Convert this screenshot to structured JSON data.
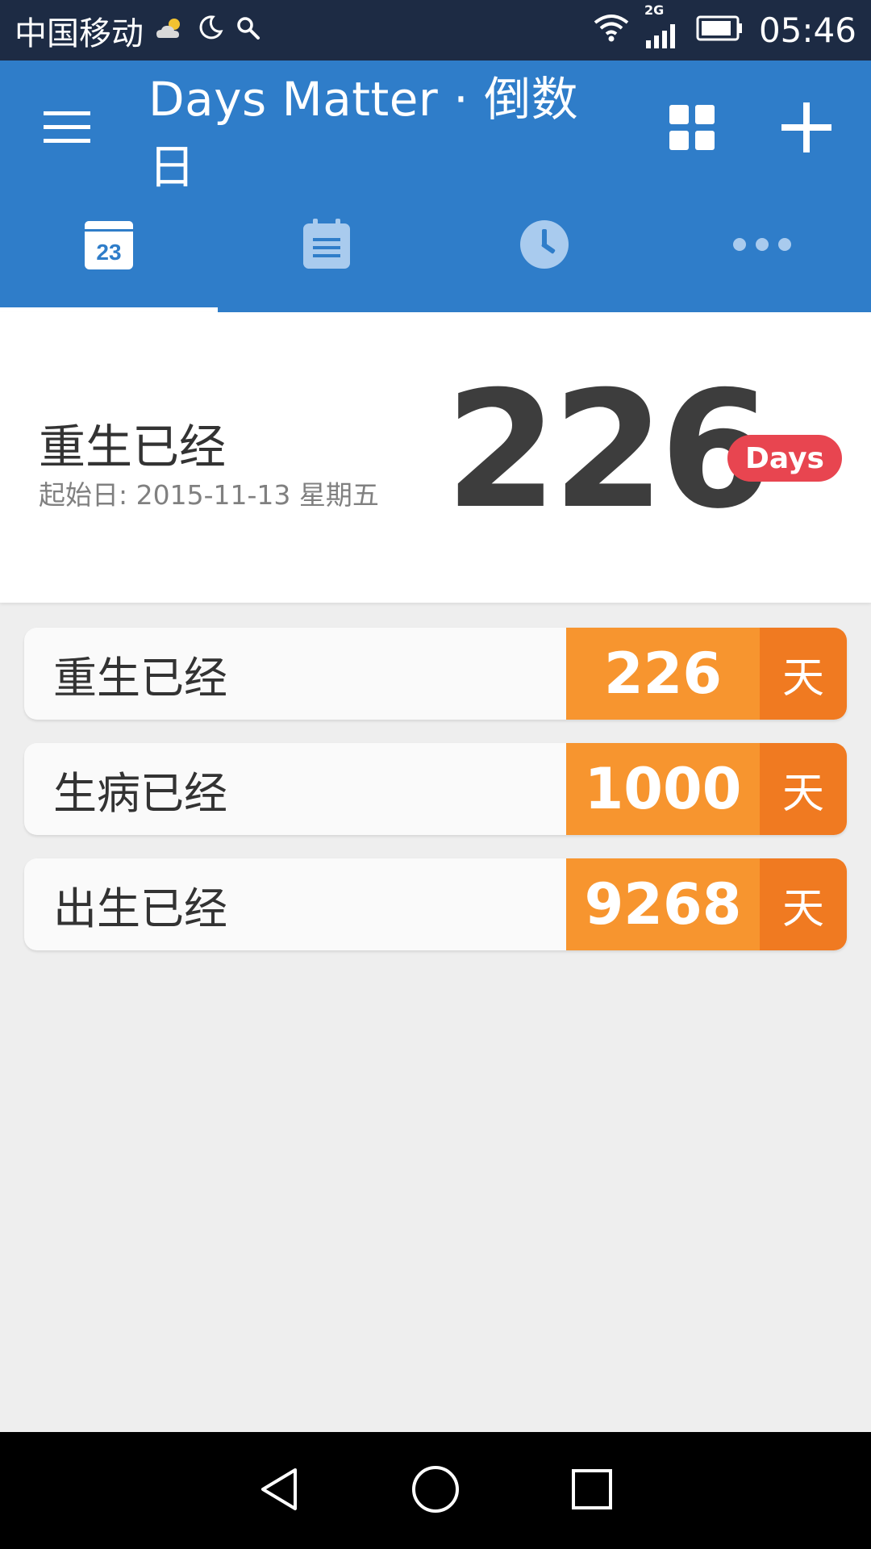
{
  "status_bar": {
    "carrier": "中国移动",
    "network_type": "2G",
    "time": "05:46"
  },
  "app_bar": {
    "title": "Days Matter · 倒数日",
    "tabs": [
      {
        "icon": "calendar-day-icon",
        "badge": "23",
        "selected": true
      },
      {
        "icon": "calendar-list-icon",
        "selected": false
      },
      {
        "icon": "clock-icon",
        "selected": false
      },
      {
        "icon": "more-dots-icon",
        "selected": false
      }
    ]
  },
  "hero": {
    "title": "重生已经",
    "subtitle": "起始日: 2015-11-13 星期五",
    "count": "226",
    "badge": "Days"
  },
  "events": [
    {
      "title": "重生已经",
      "count": "226",
      "unit": "天"
    },
    {
      "title": "生病已经",
      "count": "1000",
      "unit": "天"
    },
    {
      "title": "出生已经",
      "count": "9268",
      "unit": "天"
    }
  ],
  "colors": {
    "primary": "#2f7dc9",
    "status_bar": "#1d2b44",
    "count_bg": "#f7952f",
    "unit_bg": "#f07a21",
    "badge": "#e84550"
  }
}
